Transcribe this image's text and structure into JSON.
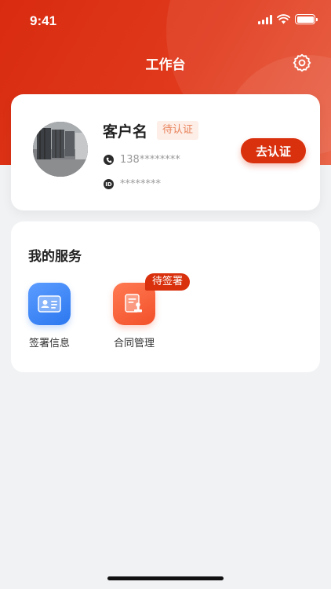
{
  "status_bar": {
    "time": "9:41"
  },
  "nav": {
    "title": "工作台"
  },
  "profile": {
    "name": "客户名",
    "status_badge": "待认证",
    "phone": "138********",
    "id_label": "ID",
    "id_number": "********",
    "verify_button": "去认证"
  },
  "services": {
    "title": "我的服务",
    "items": [
      {
        "label": "签署信息",
        "icon": "id-card-icon"
      },
      {
        "label": "合同管理",
        "icon": "contract-stamp-icon",
        "badge": "待签署"
      }
    ]
  },
  "colors": {
    "brand": "#d9310e",
    "blue": "#2c78f0",
    "orange": "#f2502a",
    "badge_bg": "#fdeee7",
    "badge_text": "#e8825a"
  }
}
